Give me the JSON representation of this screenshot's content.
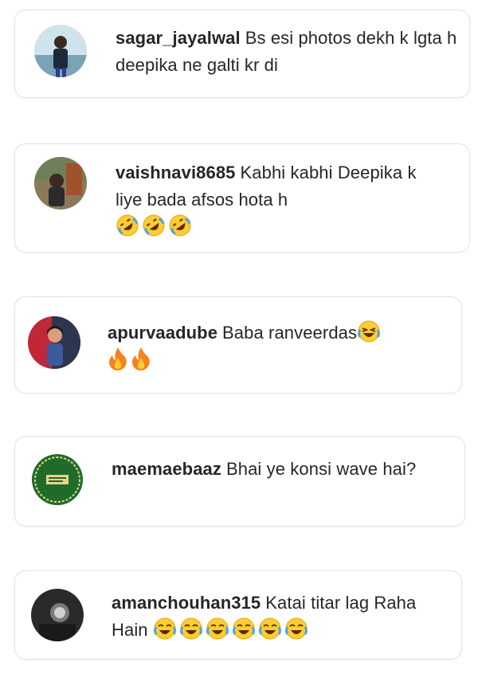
{
  "comments": [
    {
      "username": "sagar_jayalwal",
      "text": "Bs esi photos dekh k lgta h deepika ne galti kr di",
      "avatar_icon": "avatar-man-outdoor"
    },
    {
      "username": "vaishnavi8685",
      "text": "Kabhi kabhi Deepika k liye bada afsos hota h",
      "emojis": [
        "rolling-on-floor-laughing-emoji",
        "rolling-on-floor-laughing-emoji",
        "rolling-on-floor-laughing-emoji"
      ],
      "avatar_icon": "avatar-person-brown"
    },
    {
      "username": "apurvaadube",
      "text": "Baba ranveerdas",
      "emojis": [
        "grinning-squinting-tears-emoji",
        "fire-emoji",
        "fire-emoji"
      ],
      "avatar_icon": "avatar-person-red"
    },
    {
      "username": "maemaebaaz",
      "text": "Bhai ye konsi wave hai?",
      "avatar_icon": "avatar-green-badge"
    },
    {
      "username": "amanchouhan315",
      "text": "Katai titar lag Raha Hain",
      "emojis": [
        "laughing-tears-emoji",
        "laughing-tears-emoji",
        "laughing-tears-emoji",
        "laughing-tears-emoji",
        "laughing-tears-emoji",
        "laughing-tears-emoji"
      ],
      "avatar_icon": "avatar-dark-portrait"
    }
  ],
  "colors": {
    "text": "#262626",
    "card_border": "#e2e2e2",
    "emoji_yellow": "#ffcc33",
    "emoji_tear": "#4fa3e8",
    "fire_orange": "#f5821f"
  }
}
